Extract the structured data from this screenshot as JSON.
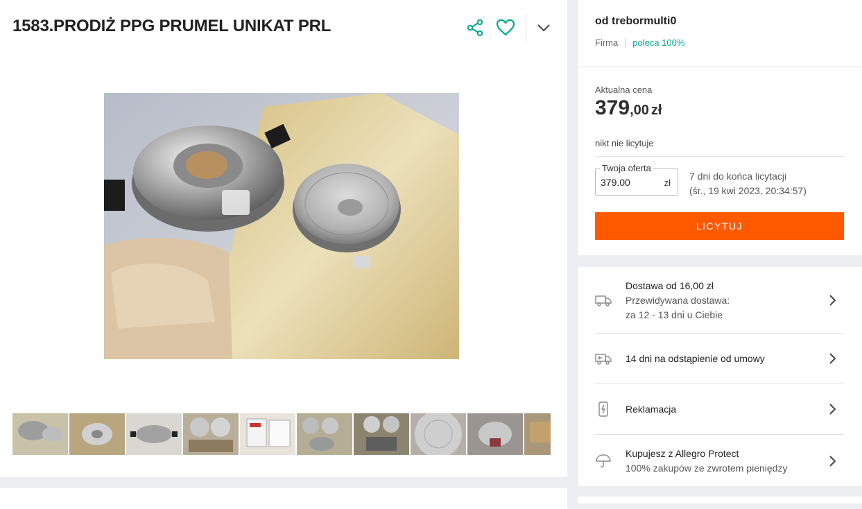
{
  "product": {
    "title": "1583.PRODIŻ PPG PRUMEL UNIKAT PRL",
    "main_photo_alt": "Prodiż photo",
    "thumbnail_count": 10
  },
  "actions": {
    "share_icon": "share-icon",
    "favorite_icon": "heart-icon",
    "more_icon": "chevron-down-icon"
  },
  "seller": {
    "name": "od trebormulti0",
    "type": "Firma",
    "recommend": "poleca 100%"
  },
  "pricing": {
    "label": "Aktualna cena",
    "price_int": "379",
    "price_dec": ",00",
    "currency": "zł",
    "bids_status": "nikt nie licytuje",
    "offer_label": "Twoja oferta",
    "offer_value": "379.00",
    "offer_currency": "zł",
    "time_left": "7 dni do końca licytacji",
    "end_date": "(śr., 19 kwi 2023, 20:34:57)",
    "bid_button": "LICYTUJ"
  },
  "info_rows": [
    {
      "icon": "truck-icon",
      "title": "Dostawa od 16,00 zł",
      "line2": "Przewidywana dostawa:",
      "line3": "za 12 - 13 dni u Ciebie"
    },
    {
      "icon": "return-truck-icon",
      "title": "14 dni na odstąpienie od umowy"
    },
    {
      "icon": "phone-icon",
      "title": "Reklamacja"
    },
    {
      "icon": "umbrella-icon",
      "title": "Kupujesz z Allegro Protect",
      "line2": "100% zakupów ze zwrotem pieniędzy"
    }
  ],
  "colors": {
    "accent": "#00a790",
    "button": "#ff5a00",
    "background": "#eceef1"
  }
}
